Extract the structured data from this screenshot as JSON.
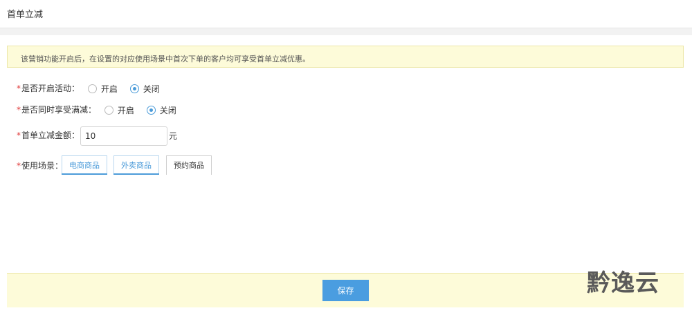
{
  "page": {
    "title": "首单立减"
  },
  "notice": {
    "text": "该营销功能开启后，在设置的对应使用场景中首次下单的客户均可享受首单立减优惠。"
  },
  "form": {
    "required_mark": "*",
    "activity": {
      "label": "是否开启活动：",
      "options": [
        {
          "label": "开启",
          "selected": false
        },
        {
          "label": "关闭",
          "selected": true
        }
      ]
    },
    "discount_combine": {
      "label": "是否同时享受满减：",
      "options": [
        {
          "label": "开启",
          "selected": false
        },
        {
          "label": "关闭",
          "selected": true
        }
      ]
    },
    "amount": {
      "label": "首单立减金额：",
      "value": "10",
      "unit": "元"
    },
    "scenes": {
      "label": "使用场景：",
      "items": [
        {
          "label": "电商商品",
          "active": true
        },
        {
          "label": "外卖商品",
          "active": true
        },
        {
          "label": "预约商品",
          "active": false
        }
      ]
    }
  },
  "footer": {
    "save_label": "保存"
  },
  "watermark": {
    "text": "黔逸云"
  },
  "colors": {
    "accent": "#4a9de0",
    "notice_bg": "#fdfbd9",
    "required": "#e03b3b"
  }
}
